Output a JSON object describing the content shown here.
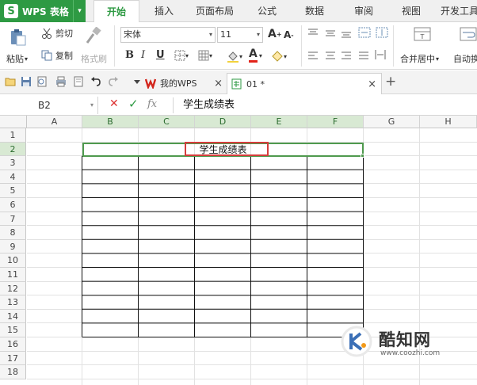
{
  "app": {
    "brand": "WPS 表格",
    "brand_letter": "S",
    "accent": "#2e9a43"
  },
  "tabs": [
    {
      "label": "开始",
      "active": true
    },
    {
      "label": "插入"
    },
    {
      "label": "页面布局"
    },
    {
      "label": "公式"
    },
    {
      "label": "数据"
    },
    {
      "label": "审阅"
    },
    {
      "label": "视图"
    },
    {
      "label": "开发工具"
    }
  ],
  "ribbon": {
    "paste": "粘贴",
    "cut": "剪切",
    "copy": "复制",
    "format_painter": "格式刷",
    "font_name": "宋体",
    "font_size": "11",
    "bold": "B",
    "italic": "I",
    "underline": "U",
    "grow_font": "A",
    "shrink_font": "A",
    "font_color_letter": "A",
    "merge_center": "合并居中",
    "wrap_text": "自动换"
  },
  "quickbar": {
    "doc_tabs": [
      {
        "label": "我的WPS",
        "close": "×"
      },
      {
        "label": "01 *",
        "close": "×"
      }
    ],
    "new_tab": "+"
  },
  "formula_bar": {
    "cell_ref": "B2",
    "fx": "fx",
    "value": "学生成绩表"
  },
  "sheet": {
    "columns": [
      "A",
      "B",
      "C",
      "D",
      "E",
      "F",
      "G",
      "H"
    ],
    "rows": [
      "1",
      "2",
      "3",
      "4",
      "5",
      "6",
      "7",
      "8",
      "9",
      "10",
      "11",
      "12",
      "13",
      "14",
      "15",
      "16",
      "17",
      "18"
    ],
    "selected_columns": [
      "B",
      "C",
      "D",
      "E",
      "F"
    ],
    "selected_row": "2",
    "title_text": "学生成绩表"
  },
  "watermark": {
    "name": "酷知网",
    "url": "www.coozhi.com"
  }
}
